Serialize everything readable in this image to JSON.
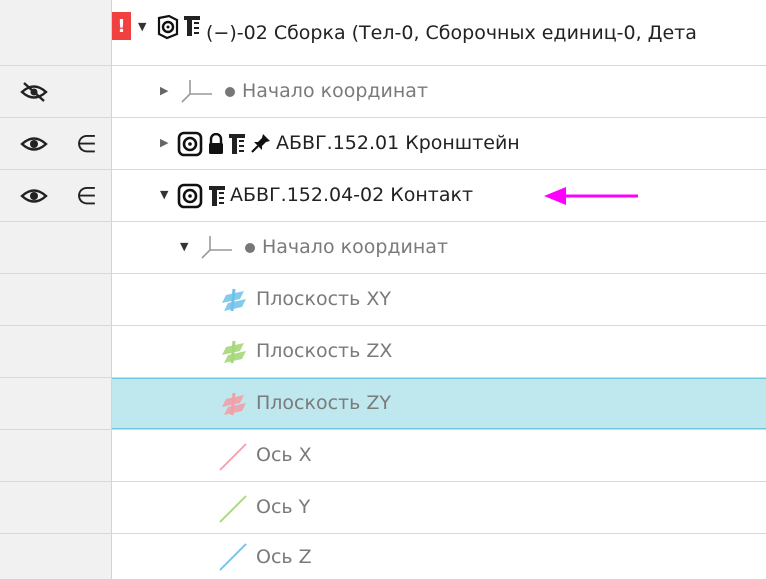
{
  "rows": [
    {
      "error_badge": "!",
      "label": "(−)-02 Сборка (Тел-0, Сборочных единиц-0, Дета"
    },
    {
      "label": "Начало координат"
    },
    {
      "label": "АБВГ.152.01 Кронштейн",
      "in_assembly_symbol": "∈"
    },
    {
      "label": "АБВГ.152.04-02 Контакт",
      "in_assembly_symbol": "∈"
    },
    {
      "label": "Начало координат"
    },
    {
      "label": "Плоскость XY"
    },
    {
      "label": "Плоскость ZX"
    },
    {
      "label": "Плоскость ZY"
    },
    {
      "label": "Ось X"
    },
    {
      "label": "Ось Y"
    },
    {
      "label": "Ось Z"
    }
  ],
  "colors": {
    "selection_bg": "#bfe7ee",
    "selection_border": "#6cc9db",
    "error_red": "#f04040",
    "annotation_arrow": "#ff00ff",
    "plane_xy": "#6ec1ea",
    "plane_zx": "#a6d77a",
    "plane_zy": "#f2a0a8",
    "axis_x": "#f2a0a8",
    "axis_y": "#a6d77a",
    "axis_z": "#6ec1ea"
  },
  "icons": [
    "eye-icon",
    "eye-off-icon",
    "element-of-icon",
    "expand-triangle-icon",
    "collapse-triangle-icon",
    "assembly-icon",
    "part-icon",
    "lock-icon",
    "pin-icon",
    "tool-column-icon",
    "coordinate-origin-icon",
    "plane-icon",
    "axis-icon",
    "annotation-arrow-icon"
  ],
  "selected_row": 7
}
